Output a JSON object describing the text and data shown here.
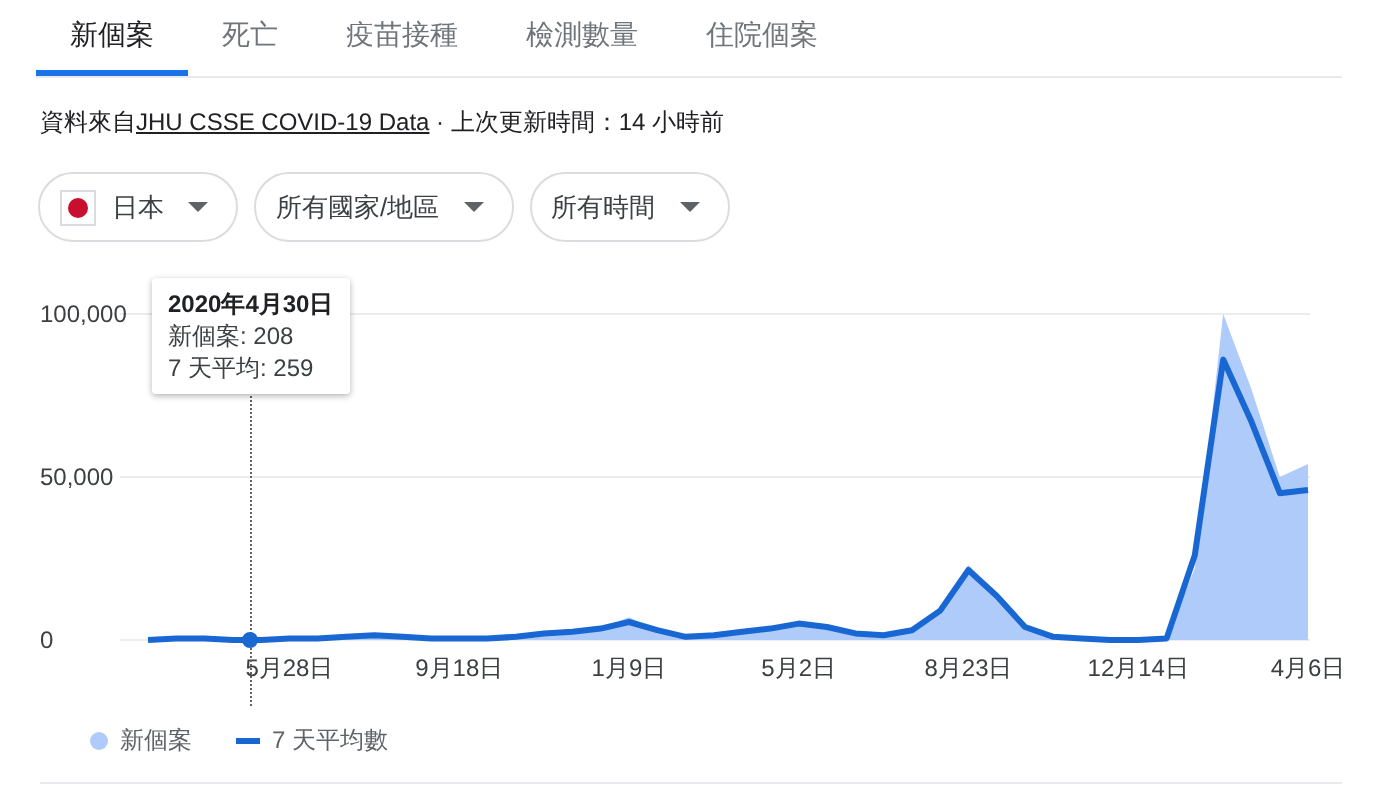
{
  "tabs": [
    {
      "label": "新個案",
      "selected": true
    },
    {
      "label": "死亡",
      "selected": false
    },
    {
      "label": "疫苗接種",
      "selected": false
    },
    {
      "label": "檢測數量",
      "selected": false
    },
    {
      "label": "住院個案",
      "selected": false
    }
  ],
  "source": {
    "prefix": "資料來自",
    "link": "JHU CSSE COVID-19 Data",
    "suffix": " · 上次更新時間：14 小時前"
  },
  "filters": [
    {
      "label": "日本",
      "kind": "country"
    },
    {
      "label": "所有國家/地區",
      "kind": "plain"
    },
    {
      "label": "所有時間",
      "kind": "plain"
    }
  ],
  "tooltip": {
    "title": "2020年4月30日",
    "lines": [
      "新個案: 208",
      "7 天平均: 259"
    ]
  },
  "chart_data": {
    "type": "line",
    "categories": [
      null,
      null,
      null,
      null,
      null,
      "5月28日",
      null,
      null,
      null,
      null,
      null,
      "9月18日",
      null,
      null,
      null,
      null,
      null,
      "1月9日",
      null,
      null,
      null,
      null,
      null,
      "5月2日",
      null,
      null,
      null,
      null,
      null,
      "8月23日",
      null,
      null,
      null,
      null,
      null,
      "12月14日",
      null,
      null,
      null,
      null,
      null,
      "4月6日"
    ],
    "series": [
      {
        "name": "新個案",
        "type": "area",
        "color": "#aecbfa",
        "values": [
          0,
          500,
          500,
          0,
          0,
          500,
          500,
          1000,
          1500,
          1000,
          500,
          500,
          500,
          1000,
          2000,
          2500,
          3500,
          7000,
          3000,
          1000,
          1500,
          2500,
          3500,
          5500,
          4000,
          2000,
          1500,
          3000,
          9000,
          23000,
          13500,
          4000,
          1000,
          500,
          0,
          0,
          500,
          22000,
          100000,
          77000,
          50000,
          54000
        ]
      },
      {
        "name": "7 天平均數",
        "type": "line",
        "color": "#1967d2",
        "values": [
          0,
          500,
          500,
          0,
          0,
          500,
          500,
          1000,
          1500,
          1000,
          500,
          500,
          500,
          1000,
          2000,
          2500,
          3500,
          5500,
          3000,
          1000,
          1500,
          2500,
          3500,
          5000,
          4000,
          2000,
          1500,
          3000,
          9000,
          21500,
          13500,
          4000,
          1000,
          500,
          0,
          0,
          500,
          26000,
          86000,
          67000,
          45000,
          46000
        ]
      }
    ],
    "ylim": [
      0,
      100000
    ],
    "yticks": [
      0,
      {
        "value": 50000,
        "label": "50,000"
      },
      {
        "value": 100000,
        "label": "100,000"
      }
    ]
  }
}
